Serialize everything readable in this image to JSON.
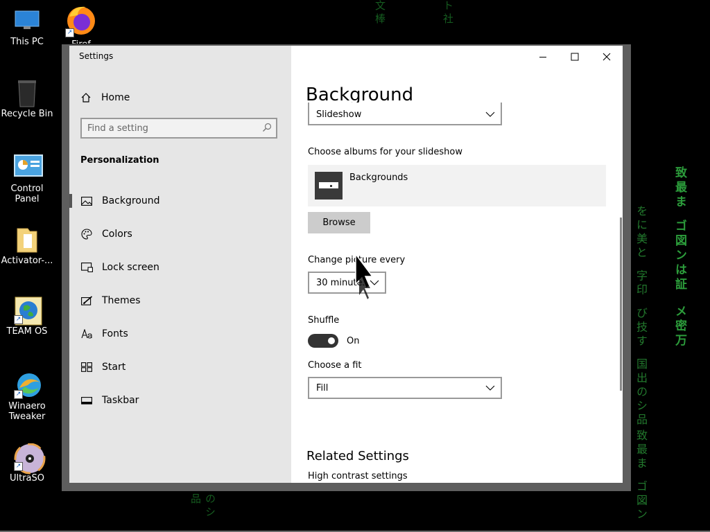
{
  "desktop": {
    "matrix_chars": [
      "文棒",
      "ト社",
      "致最ま ゴ図ンは証",
      "メ密万",
      "をに美と 字印 び技す 国出のシ品",
      "致最ま ゴ図ン",
      "のシ品"
    ],
    "icons": [
      {
        "label": "This PC"
      },
      {
        "label": "Recycle Bin"
      },
      {
        "label": "Control Panel"
      },
      {
        "label": "Activator-..."
      },
      {
        "label": "TEAM OS"
      },
      {
        "label": "Winaero Tweaker"
      },
      {
        "label": "UltraSO"
      },
      {
        "label": "Firef"
      }
    ]
  },
  "window": {
    "title": "Settings",
    "controls": {
      "minimize": "minimize",
      "maximize": "maximize",
      "close": "close"
    }
  },
  "sidebar": {
    "home_label": "Home",
    "search_placeholder": "Find a setting",
    "section_title": "Personalization",
    "items": [
      {
        "label": "Background",
        "icon": "picture-icon",
        "active": true
      },
      {
        "label": "Colors",
        "icon": "palette-icon",
        "active": false
      },
      {
        "label": "Lock screen",
        "icon": "lock-screen-icon",
        "active": false
      },
      {
        "label": "Themes",
        "icon": "brush-icon",
        "active": false
      },
      {
        "label": "Fonts",
        "icon": "font-icon",
        "active": false
      },
      {
        "label": "Start",
        "icon": "start-icon",
        "active": false
      },
      {
        "label": "Taskbar",
        "icon": "taskbar-icon",
        "active": false
      }
    ]
  },
  "content": {
    "page_title": "Background",
    "background_type_value": "Slideshow",
    "albums_label": "Choose albums for your slideshow",
    "album_name": "Backgrounds",
    "browse_label": "Browse",
    "change_picture_label": "Change picture every",
    "change_picture_value": "30 minutes",
    "shuffle_label": "Shuffle",
    "shuffle_state": "On",
    "fit_label": "Choose a fit",
    "fit_value": "Fill",
    "related_title": "Related Settings",
    "related_link": "High contrast settings"
  },
  "colors": {
    "sidebar_bg": "#e6e6e6",
    "content_bg": "#ffffff",
    "toggle_on": "#333333",
    "matrix_green": "#3bd14f"
  }
}
